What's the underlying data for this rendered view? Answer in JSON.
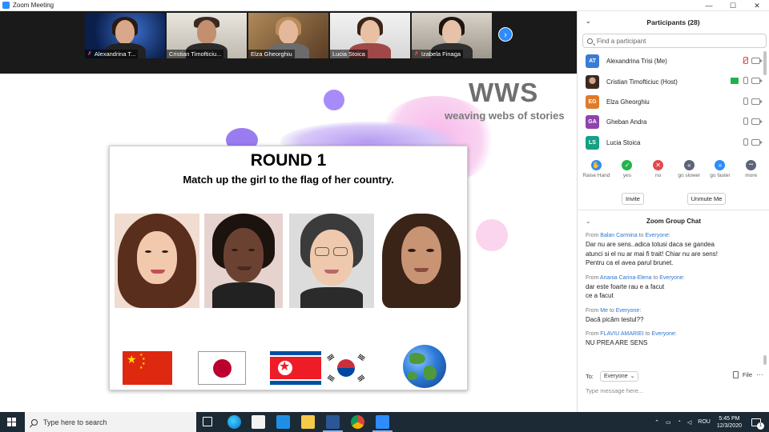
{
  "window": {
    "title": "Zoom Meeting",
    "controls": {
      "minimize": "—",
      "maximize": "☐",
      "close": "✕"
    }
  },
  "video_strip": {
    "tiles": [
      {
        "name": "Alexandrina T...",
        "muted": true
      },
      {
        "name": "Cristian Timofticiu...",
        "muted": false
      },
      {
        "name": "Elza Gheorghiu",
        "muted": false
      },
      {
        "name": "Lucia Stoica",
        "muted": false
      },
      {
        "name": "Izabela Finaga",
        "muted": true
      }
    ],
    "next_label": "›"
  },
  "slide_bg": {
    "logo": "WWS",
    "tagline": "weaving webs of stories"
  },
  "slide": {
    "title": "ROUND 1",
    "subtitle": "Match up the girl to the flag of her country."
  },
  "participants": {
    "header": "Participants (28)",
    "search_placeholder": "Find a participant",
    "list": [
      {
        "initials": "AT",
        "name": "Alexandrina Trisi (Me)",
        "color": "#3a7bd5"
      },
      {
        "initials": "",
        "name": "Cristian Timofticiuc (Host)",
        "color": "#6b4a3a"
      },
      {
        "initials": "EG",
        "name": "Elza Gheorghiu",
        "color": "#e07b2a"
      },
      {
        "initials": "GA",
        "name": "Gheban Andra",
        "color": "#8e44ad"
      },
      {
        "initials": "LS",
        "name": "Lucia Stoica",
        "color": "#16a085"
      }
    ],
    "reactions": [
      {
        "label": "Raise Hand",
        "glyph": "✋",
        "color": "#2d8cff"
      },
      {
        "label": "yes",
        "glyph": "✓",
        "color": "#22b24c"
      },
      {
        "label": "no",
        "glyph": "✕",
        "color": "#e5484d"
      },
      {
        "label": "go slower",
        "glyph": "«",
        "color": "#5b6478"
      },
      {
        "label": "go faster",
        "glyph": "»",
        "color": "#2d8cff"
      },
      {
        "label": "more",
        "glyph": "•••",
        "color": "#5b6478"
      }
    ],
    "invite_label": "Invite",
    "unmute_label": "Unmute Me"
  },
  "chat": {
    "header": "Zoom Group Chat",
    "messages": [
      {
        "from_prefix": "From ",
        "sender": "Balan Carmina",
        "to_word": " to ",
        "recipient": "Everyone",
        "suffix": ":",
        "text": "Dar nu are sens..adica totusi daca se gandea\natunci si el nu ar mai fi trait! Chiar nu are sens!\nPentru ca el avea parul brunet."
      },
      {
        "from_prefix": "From ",
        "sender": "Anania Carina-Elena",
        "to_word": " to ",
        "recipient": "Everyone",
        "suffix": ":",
        "text": "dar este foarte rau  e a facut\nce a facut"
      },
      {
        "from_prefix": "From ",
        "sender": "Me",
        "to_word": " to ",
        "recipient": "Everyone",
        "suffix": ":",
        "text": "Dacă picăm testul??"
      },
      {
        "from_prefix": "From ",
        "sender": "FLAVIU AMARIEI",
        "to_word": " to ",
        "recipient": "Everyone",
        "suffix": ":",
        "text": "NU PREA ARE SENS"
      }
    ],
    "to_label": "To:",
    "to_value": "Everyone",
    "file_label": "File",
    "input_placeholder": "Type message here..."
  },
  "taskbar": {
    "search_placeholder": "Type here to search",
    "language": "ROU",
    "time": "5:45 PM",
    "date": "12/3/2020",
    "notification_count": "1"
  }
}
